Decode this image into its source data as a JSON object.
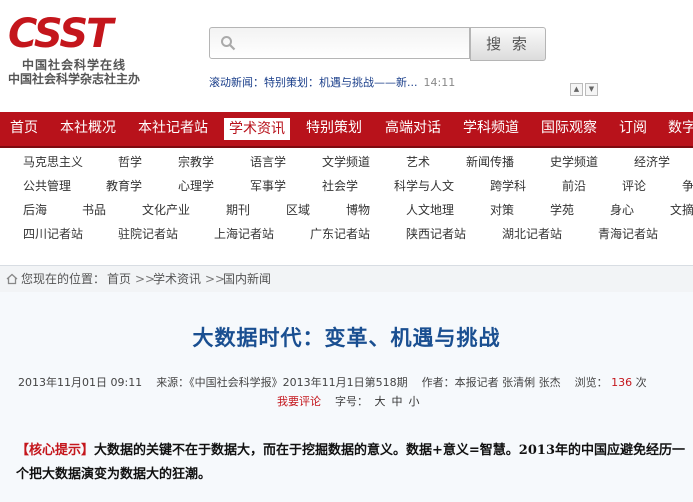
{
  "logo": {
    "mark": "CSST",
    "line1": "中国社会科学在线",
    "line2": "中国社会科学杂志社主办"
  },
  "search": {
    "placeholder": "",
    "button_label": "搜 索"
  },
  "ticker": {
    "label": "滚动新闻：",
    "text": "特别策划：机遇与挑战——新...",
    "time": "14:11"
  },
  "nav": {
    "items": [
      "首页",
      "本社概况",
      "本社记者站",
      "学术资讯",
      "特别策划",
      "高端对话",
      "学科频道",
      "国际观察",
      "订阅",
      "数字"
    ],
    "active": "学术资讯"
  },
  "subnav": {
    "row1": [
      "马克思主义",
      "哲学",
      "宗教学",
      "语言学",
      "文学频道",
      "艺术",
      "新闻传播",
      "史学频道",
      "经济学"
    ],
    "row2": [
      "公共管理",
      "教育学",
      "心理学",
      "军事学",
      "社会学",
      "科学与人文",
      "跨学科",
      "前沿",
      "评论",
      "争"
    ],
    "row3": [
      "后海",
      "书品",
      "文化产业",
      "期刊",
      "区域",
      "博物",
      "人文地理",
      "对策",
      "学苑",
      "身心",
      "文摘"
    ],
    "row4": [
      "四川记者站",
      "驻院记者站",
      "上海记者站",
      "广东记者站",
      "陕西记者站",
      "湖北记者站",
      "青海记者站"
    ]
  },
  "breadcrumb": {
    "prefix": "您现在的位置：",
    "sep": ">>",
    "items": [
      "首页",
      "学术资讯",
      "国内新闻"
    ]
  },
  "article": {
    "title": "大数据时代：变革、机遇与挑战",
    "date": "2013年11月01日 09:11",
    "source": "来源：《中国社会科学报》2013年11月1日第518期",
    "author": "作者：本报记者 张清俐 张杰",
    "views_label": "浏览：",
    "views": "136",
    "views_unit": "次",
    "comment": "我要评论",
    "fontsize_label": "字号：",
    "fontsizes": [
      "大",
      "中",
      "小"
    ],
    "hint_tag": "【核心提示】",
    "hint_text": "大数据的关键不在于数据大，而在于挖掘数据的意义。数据+意义=智慧。2013年的中国应避免经历一个把大数据演变为数据大的狂潮。"
  },
  "colors": {
    "brand_red": "#b8121b",
    "title_blue": "#1a4f91"
  }
}
